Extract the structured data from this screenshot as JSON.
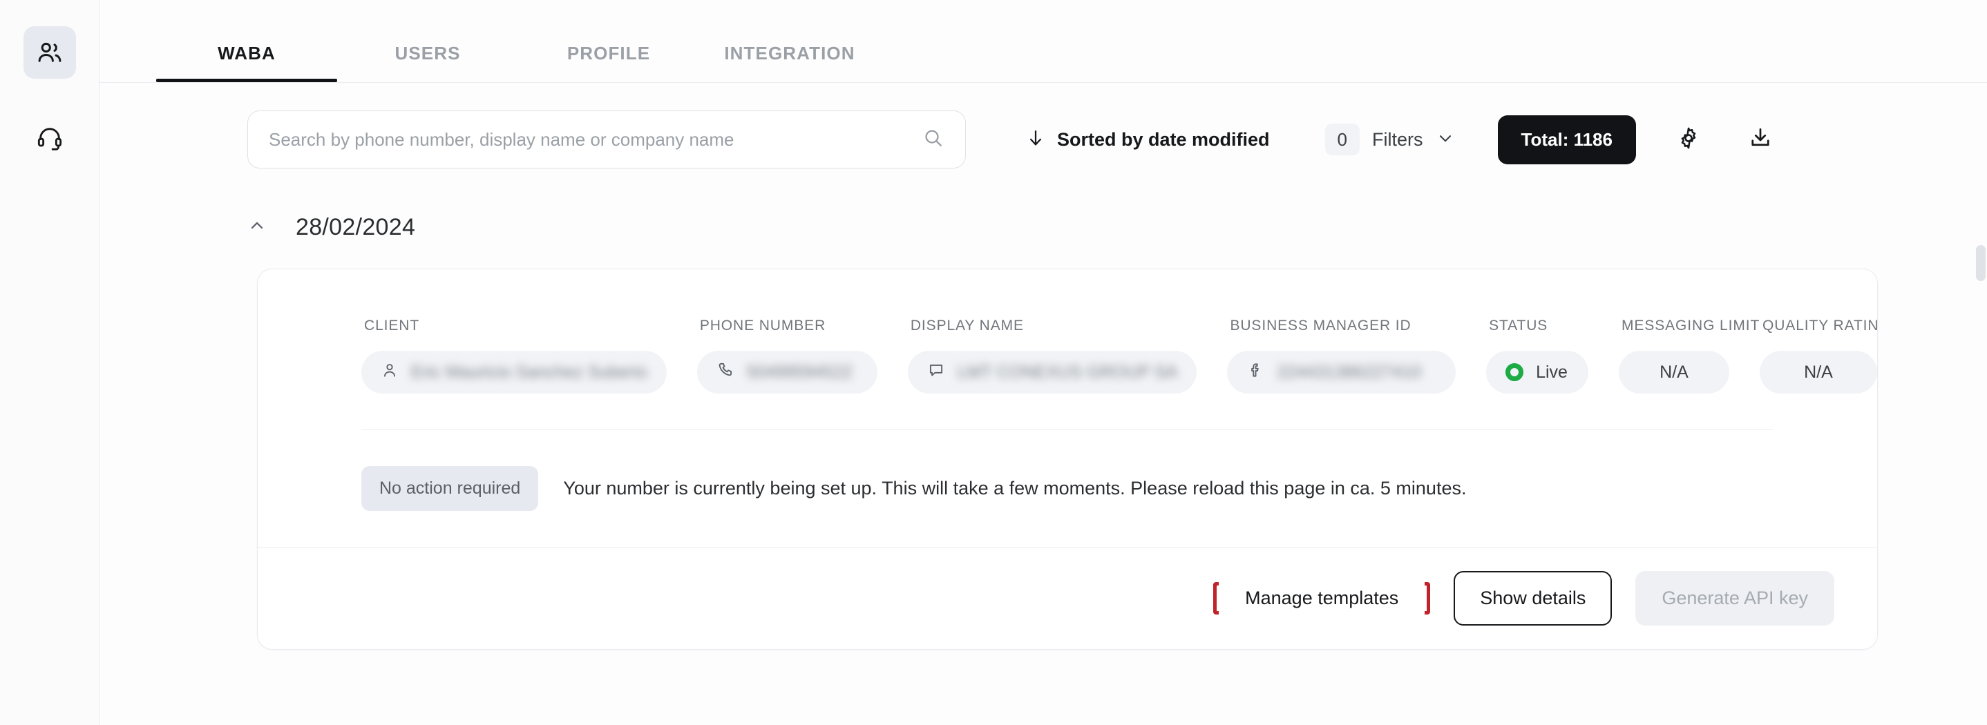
{
  "sidebar": {
    "items": [
      {
        "name": "users",
        "icon": "users-icon",
        "active": true
      },
      {
        "name": "support",
        "icon": "headset-icon",
        "active": false
      }
    ]
  },
  "tabs": [
    {
      "label": "WABA",
      "active": true
    },
    {
      "label": "USERS",
      "active": false
    },
    {
      "label": "PROFILE",
      "active": false
    },
    {
      "label": "INTEGRATION",
      "active": false
    }
  ],
  "toolbar": {
    "search_placeholder": "Search by phone number, display name or company name",
    "search_value": "",
    "search_icon": "search-icon",
    "sort_label": "Sorted by date modified",
    "sort_icon": "arrow-down-icon",
    "filters_count": "0",
    "filters_label": "Filters",
    "filters_chevron": "chevron-down-icon",
    "total_label": "Total: 1186",
    "settings_icon": "gear-icon",
    "download_icon": "download-icon"
  },
  "group": {
    "collapse_icon": "chevron-up-icon",
    "date": "28/02/2024"
  },
  "table": {
    "headers": [
      "CLIENT",
      "PHONE NUMBER",
      "DISPLAY NAME",
      "BUSINESS MANAGER ID",
      "STATUS",
      "MESSAGING LIMIT",
      "QUALITY RATING"
    ],
    "row": {
      "client": "Eric Mauricio Sanchez Suberio",
      "client_icon": "person-icon",
      "phone_number": "50499594522",
      "phone_icon": "phone-icon",
      "display_name": "LMT CONEXUS GROUP SA",
      "display_icon": "chat-bubble-icon",
      "business_manager_id": "224431386227410",
      "business_icon": "facebook-icon",
      "status": "Live",
      "status_color": "#1cab45",
      "messaging_limit": "N/A",
      "quality_rating": "N/A"
    }
  },
  "notice": {
    "badge": "No action required",
    "message": "Your number is currently being set up. This will take a few moments. Please reload this page in ca. 5 minutes."
  },
  "actions": {
    "manage_templates": "Manage templates",
    "show_details": "Show details",
    "generate_api_key": "Generate API key",
    "highlight_color": "#c0232a"
  }
}
